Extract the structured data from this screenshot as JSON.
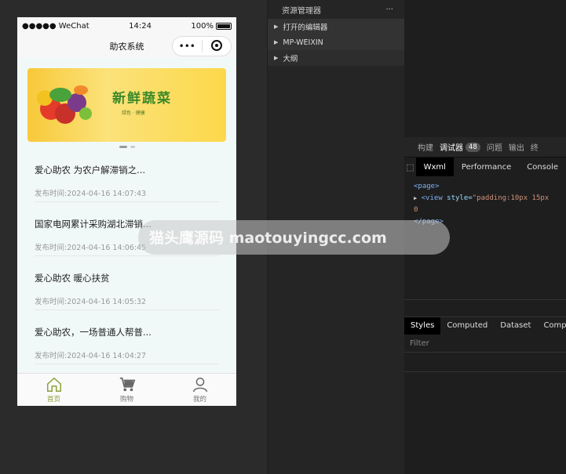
{
  "status": {
    "carrier": "●●●●● WeChat",
    "time": "14:24",
    "battery": "100%"
  },
  "nav": {
    "title": "助农系统",
    "more": "•••"
  },
  "banner": {
    "title": "新鲜蔬菜",
    "subtitle": "绿色 · 健康"
  },
  "news": [
    {
      "title": "爱心助农 为农户解滞销之...",
      "time": "发布时间:2024-04-16 14:07:43"
    },
    {
      "title": "国家电网累计采购湖北滞销...",
      "time": "发布时间:2024-04-16 14:06:45"
    },
    {
      "title": "爱心助农 暖心扶贫",
      "time": "发布时间:2024-04-16 14:05:32"
    },
    {
      "title": "爱心助农，一场普通人帮普...",
      "time": "发布时间:2024-04-16 14:04:27"
    }
  ],
  "tabbar": [
    {
      "label": "首页",
      "icon": "home-icon"
    },
    {
      "label": "购物",
      "icon": "cart-icon"
    },
    {
      "label": "我的",
      "icon": "user-icon"
    }
  ],
  "explorer": {
    "title": "资源管理器",
    "more": "···",
    "items": [
      "打开的编辑器",
      "MP-WEIXIN",
      "大纲"
    ]
  },
  "debugger": {
    "tabs": [
      "构建",
      "调试器",
      "问题",
      "输出",
      "终"
    ],
    "badge": "48",
    "subtabs": [
      "Wxml",
      "Performance",
      "Console"
    ],
    "xml": {
      "open": "<page>",
      "line_pre": "<view ",
      "attr": "style=",
      "val": "\"padding:10px 15px 0",
      "close": "</page>"
    },
    "style_tabs": [
      "Styles",
      "Computed",
      "Dataset",
      "Compon"
    ],
    "filter": "Filter"
  },
  "watermark": "猫头鹰源码 maotouyingcc.com",
  "colors": {
    "accent": "#8aa03a",
    "bg": "#2b2b2b",
    "banner": "#f8c93a"
  }
}
